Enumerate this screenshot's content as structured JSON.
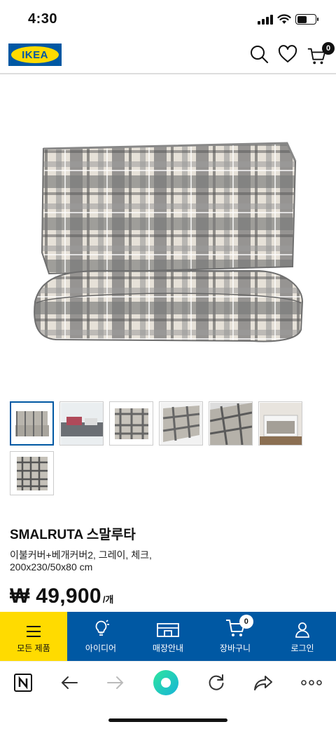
{
  "status_bar": {
    "time": "4:30"
  },
  "header": {
    "logo_text": "IKEA",
    "cart_count": "0",
    "brand_blue": "#0058a3",
    "brand_yellow": "#ffdb00"
  },
  "product": {
    "name": "SMALRUTA 스말루타",
    "description": "이불커버+베개커버2, 그레이, 체크, 200x230/50x80 cm",
    "price": "₩ 49,900",
    "price_unit": "/개",
    "thumbnail_count": 7,
    "selected_thumbnail": 1
  },
  "bottom_nav": {
    "items": [
      {
        "label": "모든 제품",
        "icon": "menu-icon"
      },
      {
        "label": "아이디어",
        "icon": "lightbulb-icon"
      },
      {
        "label": "매장안내",
        "icon": "store-icon"
      },
      {
        "label": "장바구니",
        "icon": "cart-icon"
      },
      {
        "label": "로그인",
        "icon": "user-icon"
      }
    ],
    "cart_badge": "0"
  },
  "browser_toolbar": {
    "icons": [
      "naver-icon",
      "back-arrow-icon",
      "forward-arrow-icon",
      "home-dot-icon",
      "refresh-icon",
      "share-icon",
      "more-icon"
    ]
  }
}
